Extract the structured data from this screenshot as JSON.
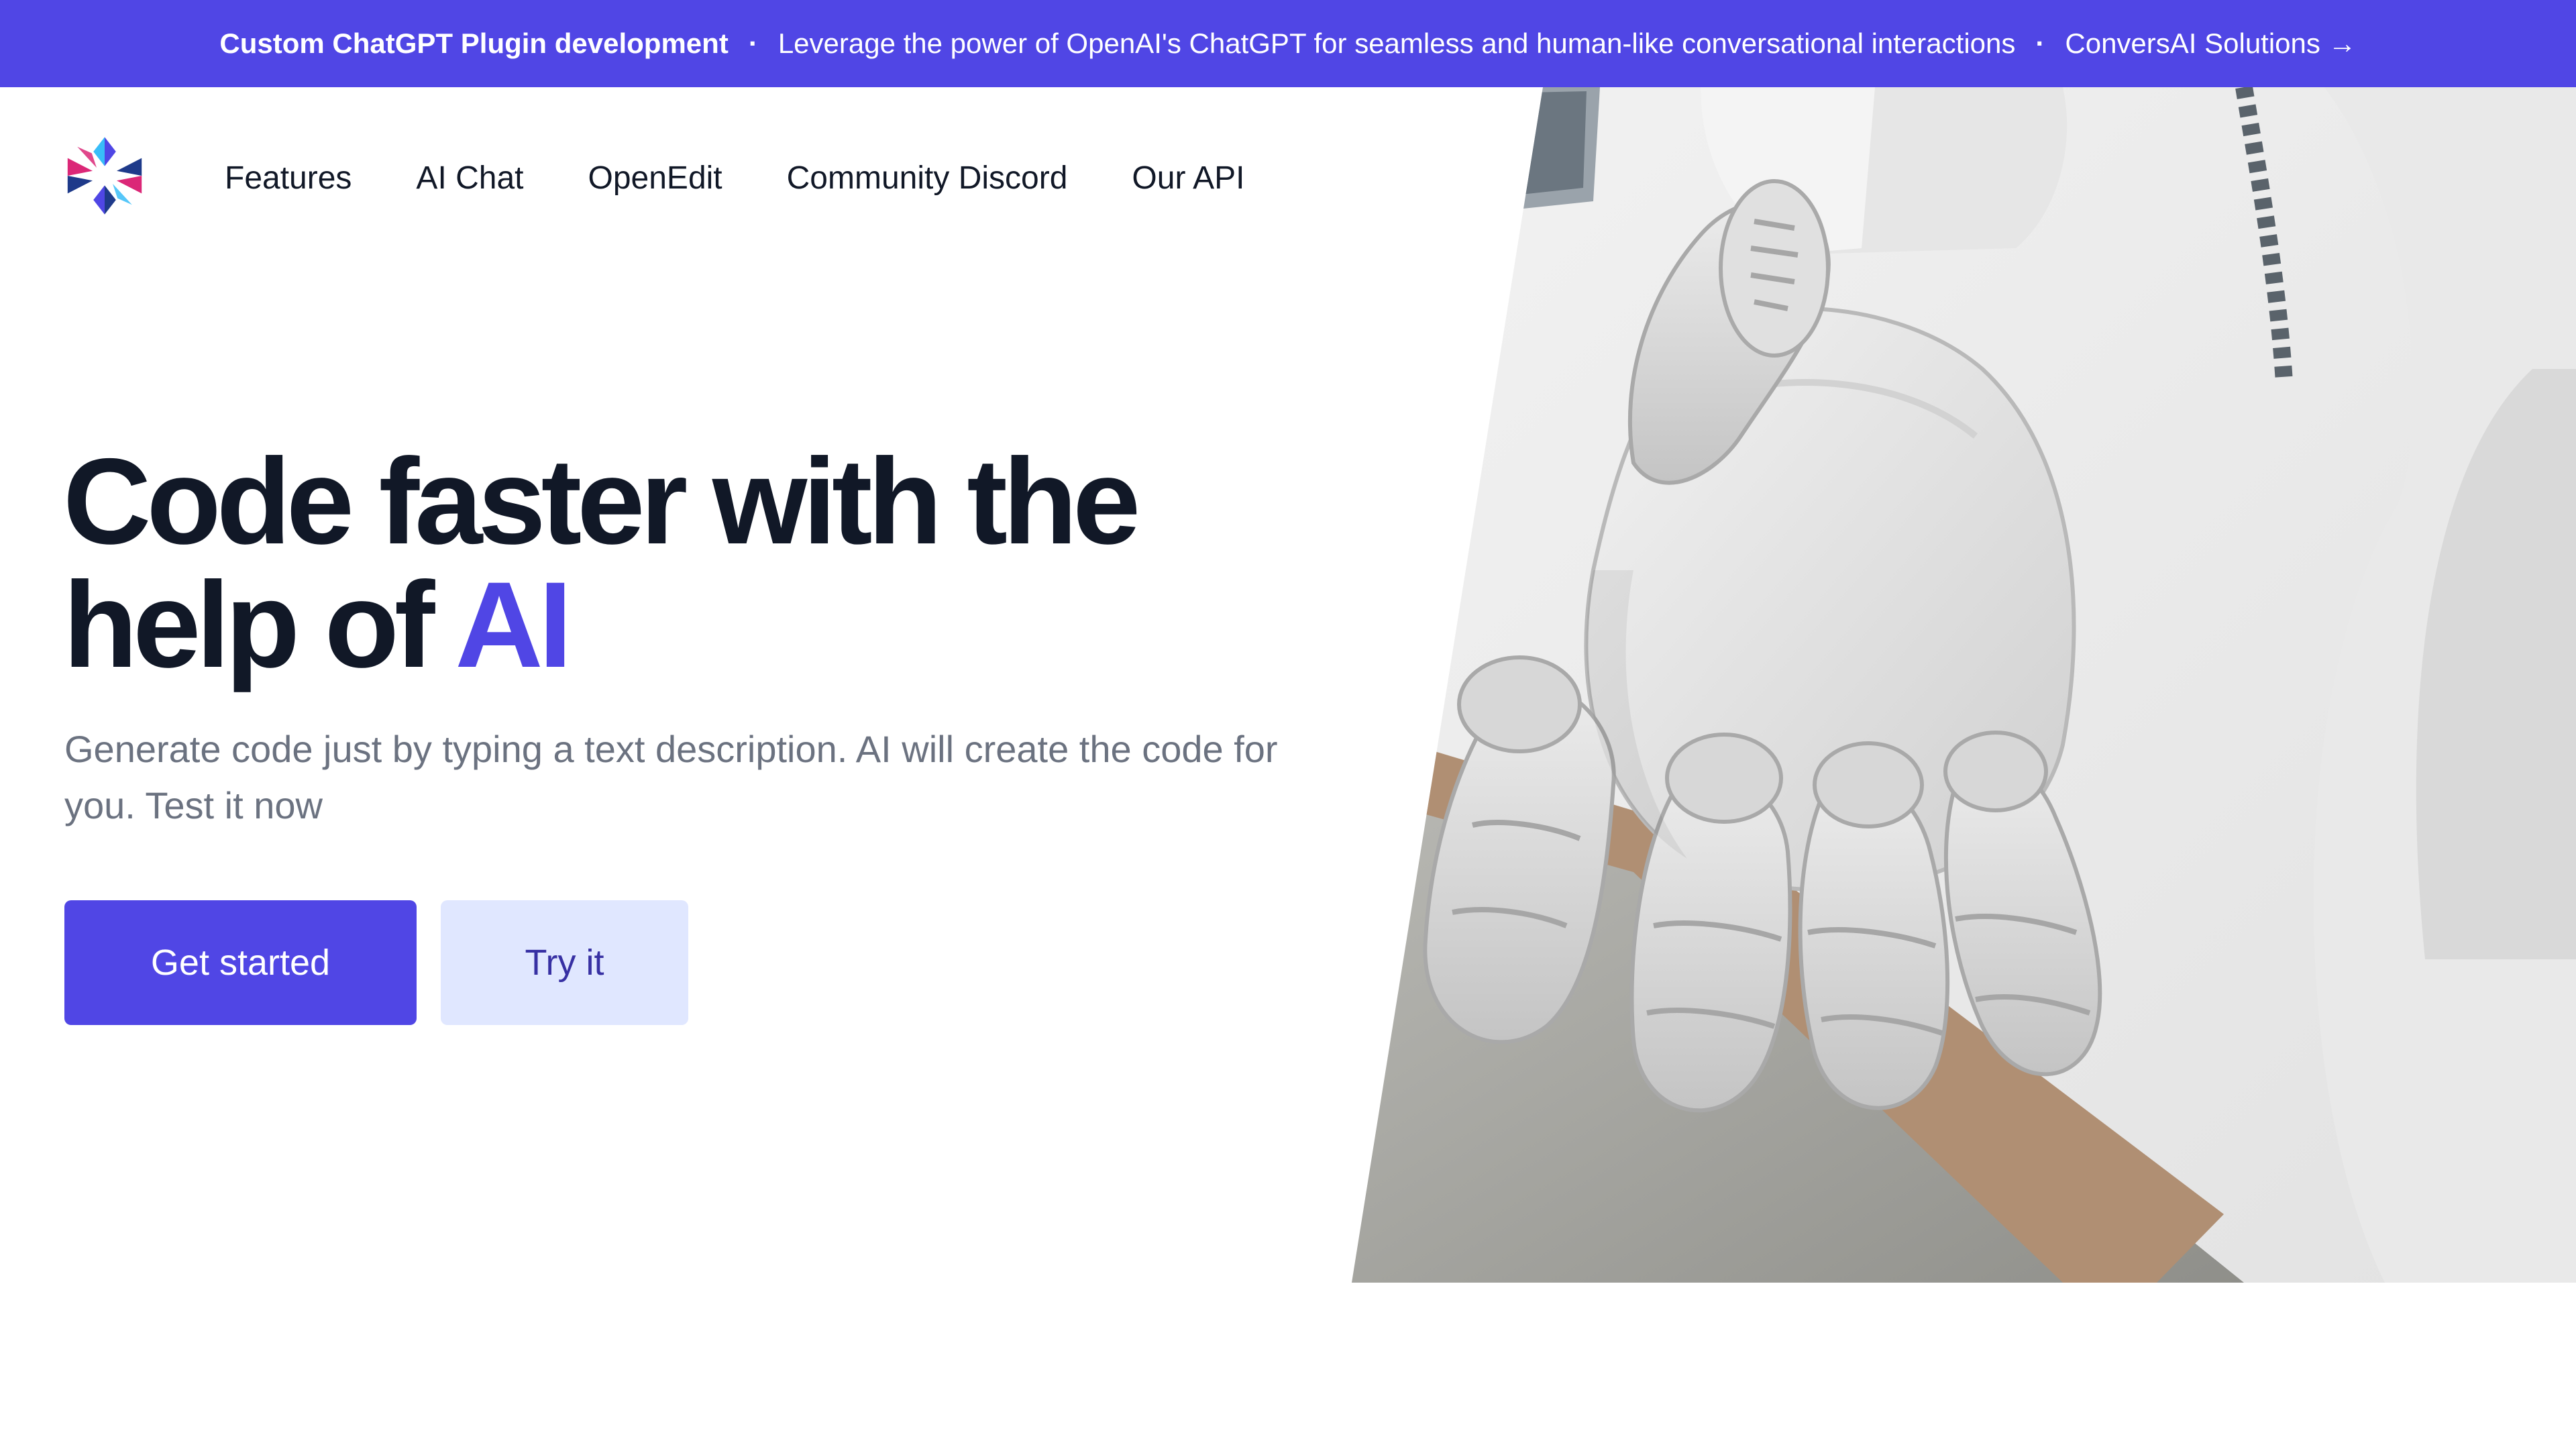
{
  "banner": {
    "title": "Custom ChatGPT Plugin development",
    "separator": "·",
    "message": "Leverage the power of OpenAI's ChatGPT for seamless and human-like conversational interactions",
    "link_label": "ConversAI Solutions →"
  },
  "header": {
    "logo_icon": "snowflake-logo-icon",
    "nav": [
      {
        "label": "Features"
      },
      {
        "label": "AI Chat"
      },
      {
        "label": "OpenEdit"
      },
      {
        "label": "Community Discord"
      },
      {
        "label": "Our API"
      }
    ]
  },
  "hero": {
    "title_part1": "Code faster with the help of ",
    "title_accent": "AI",
    "subtitle": "Generate code just by typing a text description. AI will create the code for you. Test it now",
    "primary_button": "Get started",
    "secondary_button": "Try it",
    "image_icon": "robot-hand-image"
  },
  "colors": {
    "brand": "#5046e5",
    "heading": "#111827",
    "muted": "#6b7280",
    "secondary_bg": "#e0e7ff",
    "logo_pink": "#db2777",
    "logo_blue": "#1e3a8a",
    "logo_indigo": "#4f46e5",
    "logo_cyan": "#38bdf8"
  }
}
